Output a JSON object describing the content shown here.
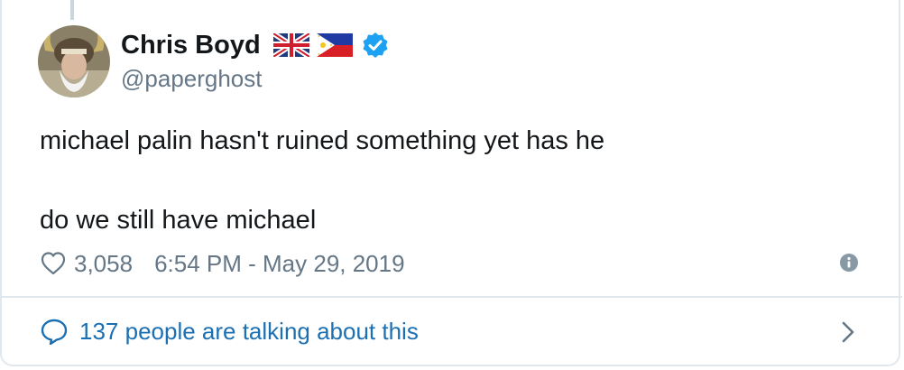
{
  "user": {
    "display_name": "Chris Boyd",
    "handle": "@paperghost",
    "flags": [
      "uk-flag-icon",
      "philippines-flag-icon"
    ],
    "verified": true
  },
  "tweet": {
    "lines": [
      "michael palin hasn't ruined something yet has he",
      "do we still have michael"
    ],
    "likes": "3,058",
    "timestamp": "6:54 PM - May 29, 2019"
  },
  "footer": {
    "talking_label": "137 people are talking about this"
  },
  "colors": {
    "text": "#14171a",
    "muted": "#657786",
    "link": "#1b6fb3",
    "verified": "#1da1f2",
    "border": "#e1e8ed"
  },
  "icons": {
    "heart": "heart-icon",
    "info": "info-icon",
    "comment": "comment-bubble-icon",
    "chevron": "chevron-right-icon",
    "verified": "verified-badge-icon"
  }
}
